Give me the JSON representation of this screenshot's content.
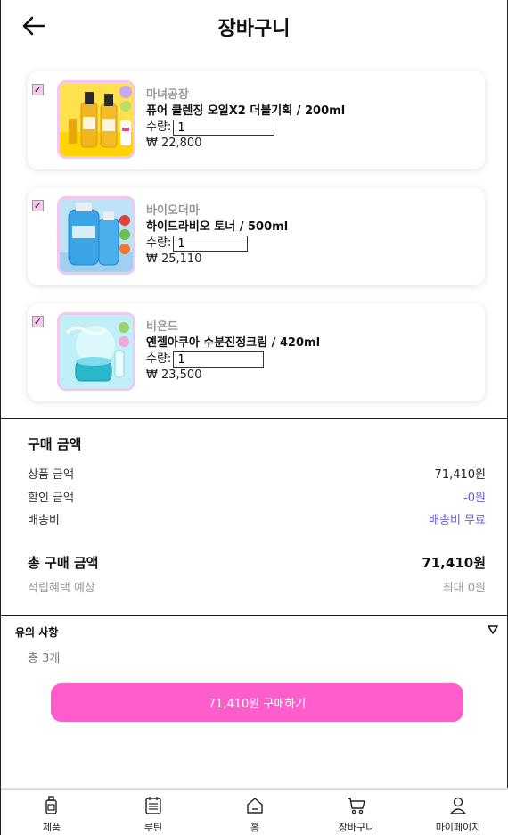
{
  "header": {
    "title": "장바구니",
    "back_icon": "arrow-left-icon"
  },
  "cart_items": [
    {
      "brand": "마녀공장",
      "name": "퓨어 클렌징 오일X2 더블기획 / 200ml",
      "qty_label": "수량:",
      "qty": "1",
      "price": "₩ 22,800",
      "checked": true,
      "checkmark": "✓"
    },
    {
      "brand": "바이오더마",
      "name": "하이드라비오 토너 / 500ml",
      "qty_label": "수량:",
      "qty": "1",
      "price": "₩ 25,110",
      "checked": true,
      "checkmark": "✓"
    },
    {
      "brand": "비욘드",
      "name": "엔젤아쿠아 수분진정크림 / 420ml",
      "qty_label": "수량:",
      "qty": "1",
      "price": "₩ 23,500",
      "checked": true,
      "checkmark": "✓"
    }
  ],
  "summary": {
    "title": "구매 금액",
    "product_amount_label": "상품 금액",
    "product_amount": "71,410원",
    "discount_label": "할인 금액",
    "discount": "-0원",
    "shipping_label": "배송비",
    "shipping": "배송비 무료",
    "total_label": "총 구매 금액",
    "total": "71,410원",
    "reward_label": "적립혜택 예상",
    "reward": "최대 0원"
  },
  "notice": {
    "title": "유의 사항",
    "count": "총 3개"
  },
  "buy_button": {
    "label": "71,410원 구매하기",
    "color": "#ff5ccc"
  },
  "colors": {
    "accent": "#6b5cd6",
    "pink": "#ff5ccc",
    "thumb_border": "#f3c7f0"
  },
  "bottom_nav": [
    {
      "label": "제품",
      "icon": "bottle-icon"
    },
    {
      "label": "루틴",
      "icon": "calendar-icon"
    },
    {
      "label": "홈",
      "icon": "home-icon"
    },
    {
      "label": "장바구니",
      "icon": "cart-icon"
    },
    {
      "label": "마이페이지",
      "icon": "user-icon"
    }
  ]
}
